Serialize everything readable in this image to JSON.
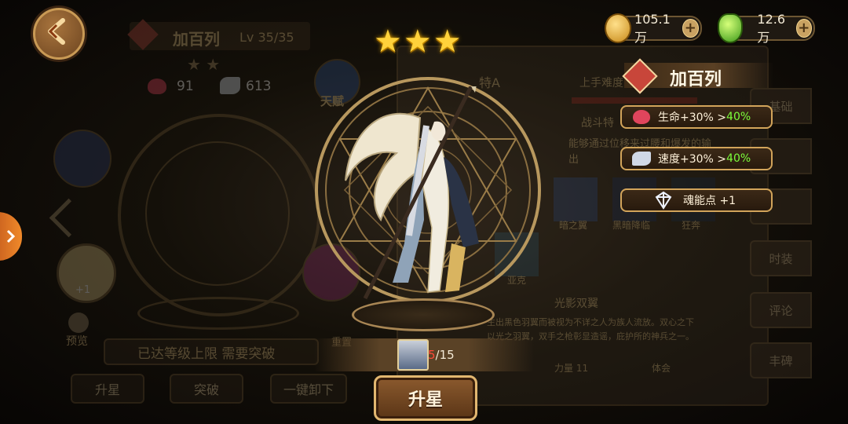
{
  "hero": {
    "name": "加百列",
    "level": "Lv 35/35",
    "hp": "91",
    "speed": "613",
    "small_stars": "★ ★"
  },
  "currency": {
    "gold": "105.1万",
    "gems": "12.6万"
  },
  "upgrade": {
    "banner_name": "加百列",
    "stats": [
      {
        "prefix": "生命+30% > ",
        "value": "40%"
      },
      {
        "prefix": "速度+30% > ",
        "value": "40%"
      }
    ],
    "soul": "魂能点 +1",
    "shard_current": "5",
    "shard_total": "/15",
    "star_button": "升星"
  },
  "left_panel": {
    "talent": "天赋",
    "preview": "预览",
    "badge_count": "+1",
    "max_level_msg": "已达等级上限 需要突破",
    "btn_star": "升星",
    "btn_break": "突破",
    "btn_unequip": "一键卸下",
    "rebirth": "重置"
  },
  "right_panel": {
    "header": "上手难度",
    "attr": "特A",
    "battle": "战斗特",
    "desc1": "能够通过位移来过腰和爆发的输",
    "desc2": "出",
    "skills": [
      "暗之翼",
      "黑暗降临",
      "狂奔"
    ],
    "skill_extra": "亚克",
    "story_title": "光影双翼",
    "story1": "生出黑色羽翼而被视为不详之人为族人流放。双心之下",
    "story2": "以光之羽翼，双手之枪彰显造谣，庇护所的神兵之一。",
    "power": "力量 11",
    "agi": "体会"
  },
  "sidebar_tabs": [
    "基础",
    "",
    "",
    "时装",
    "评论",
    "丰碑"
  ],
  "colors": {
    "gold_border": "#d2a45a",
    "green_value": "#7cff3b",
    "red_shard": "#ff4a3a"
  }
}
